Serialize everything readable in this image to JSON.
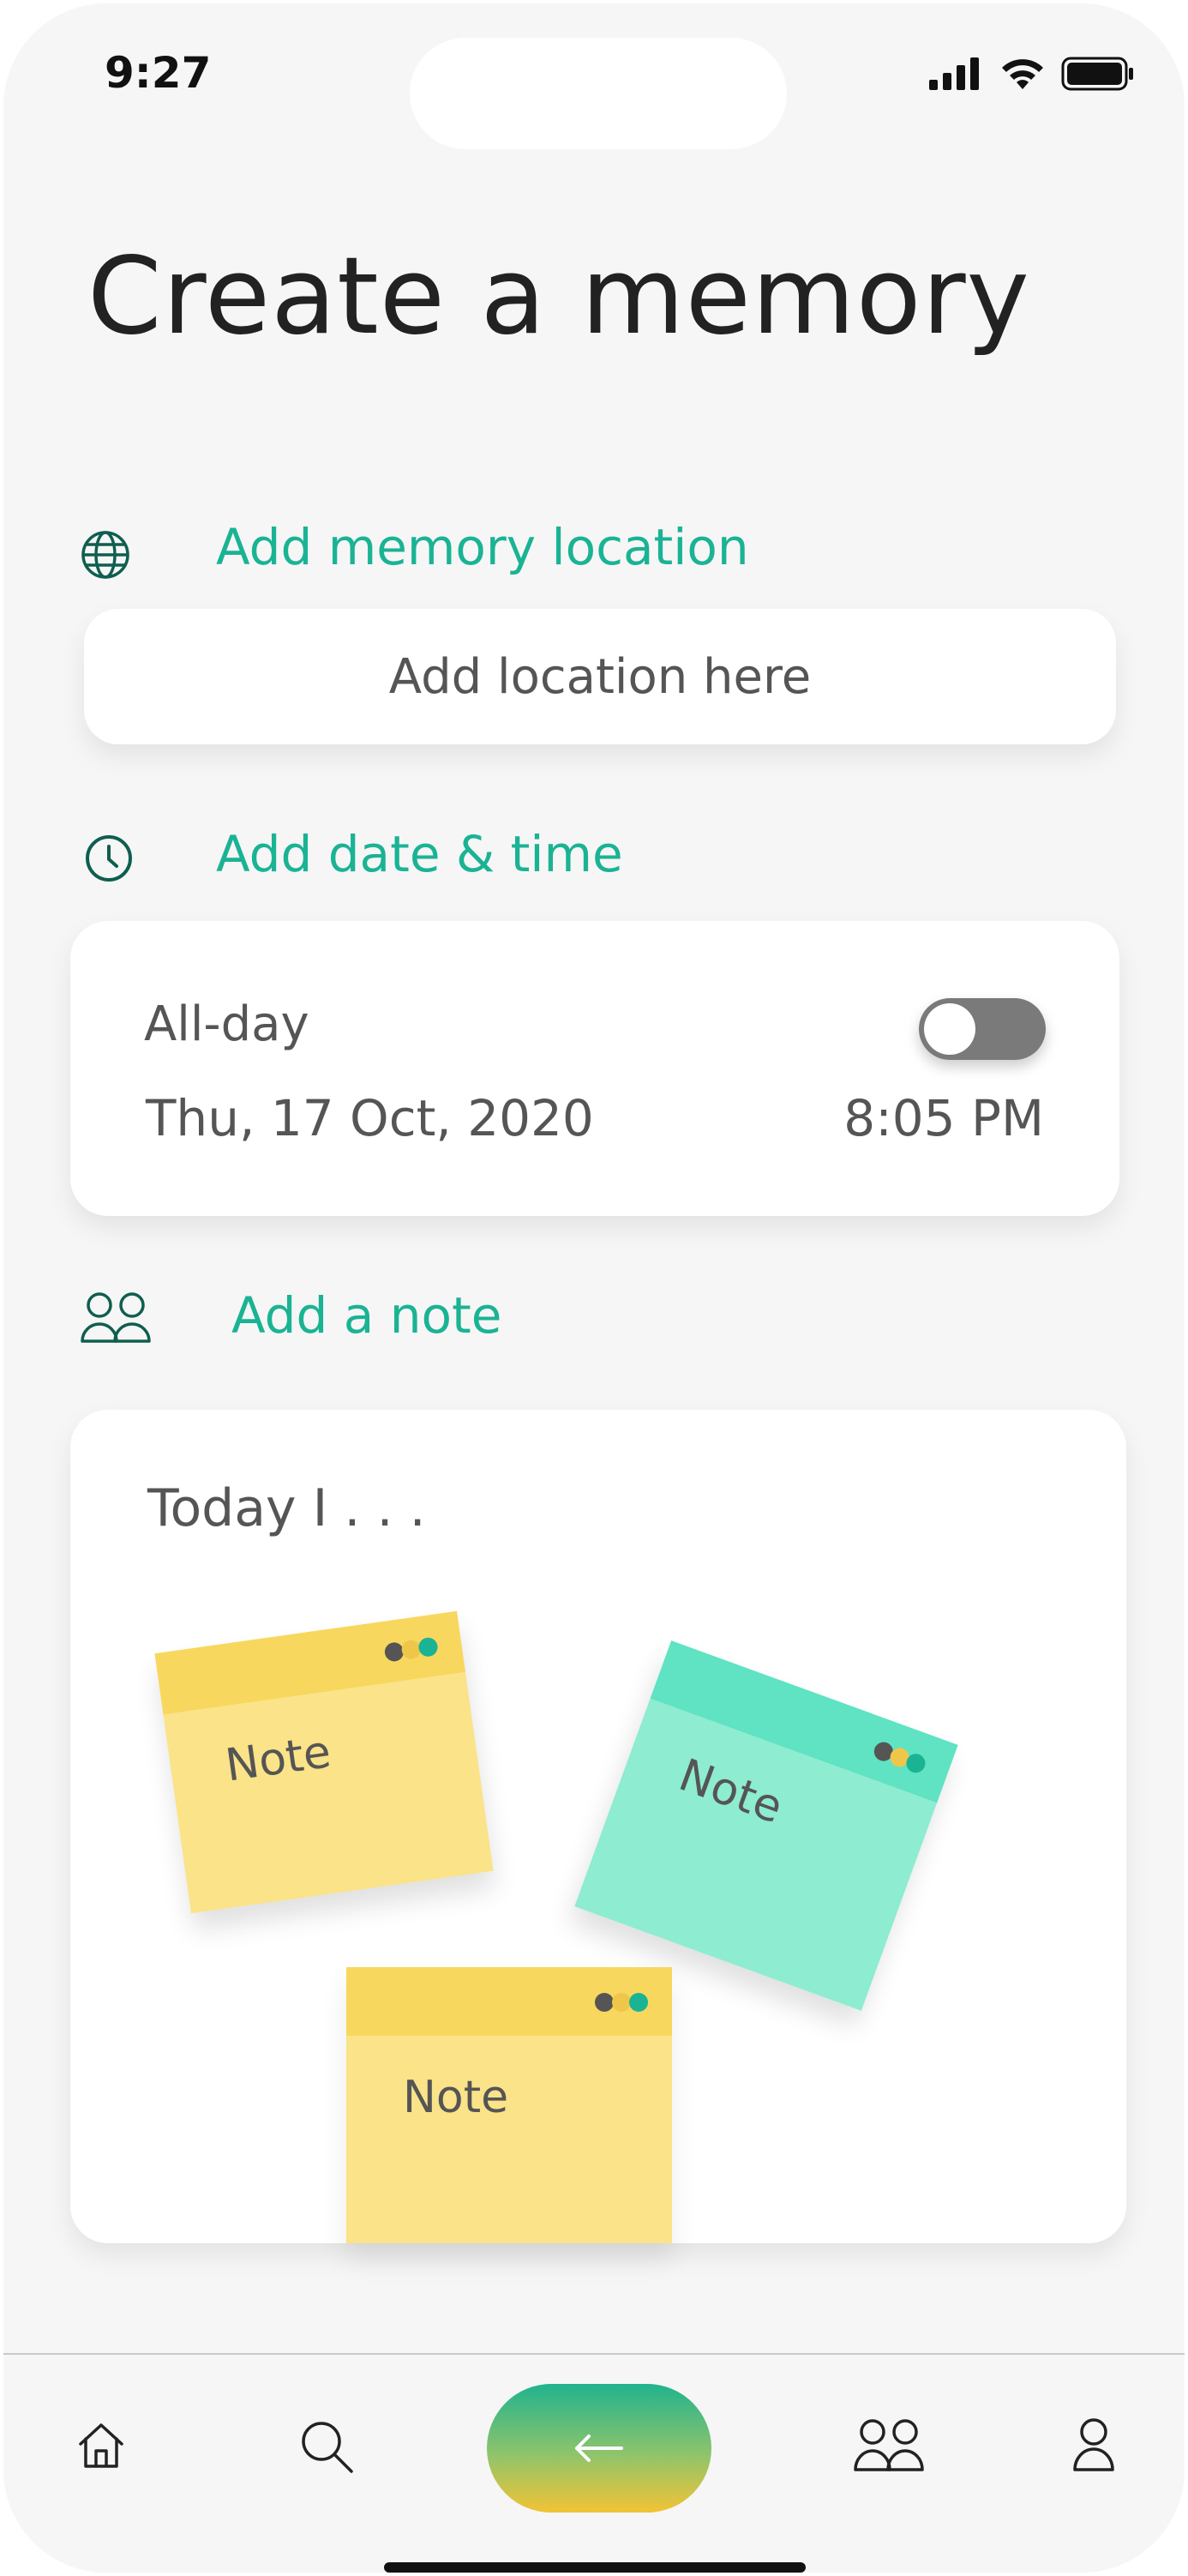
{
  "status_bar": {
    "time": "9:27"
  },
  "page": {
    "title": "Create a memory"
  },
  "location": {
    "label": "Add memory location",
    "placeholder": "Add location here",
    "icon": "globe-icon"
  },
  "datetime": {
    "label": "Add date & time",
    "icon": "clock-icon",
    "all_day_label": "All-day",
    "all_day_enabled": false,
    "date": "Thu, 17 Oct, 2020",
    "time": "8:05 PM"
  },
  "note": {
    "label": "Add a note",
    "icon": "people-icon",
    "placeholder": "Today I . . .",
    "stickies": [
      {
        "text": "Note",
        "color": "#fae388",
        "header_color": "#f8d75e"
      },
      {
        "text": "Note",
        "color": "#8eecd0",
        "header_color": "#5fe3c2"
      },
      {
        "text": "Note",
        "color": "#fae388",
        "header_color": "#f8d75e"
      }
    ]
  },
  "bottom_nav": {
    "items": [
      "home-icon",
      "search-icon",
      "back-arrow-icon",
      "group-icon",
      "profile-icon"
    ]
  },
  "colors": {
    "accent": "#1ab394",
    "background": "#f6f6f6",
    "card": "#ffffff",
    "text": "#555555",
    "toggle_off": "#7a7a7a"
  }
}
